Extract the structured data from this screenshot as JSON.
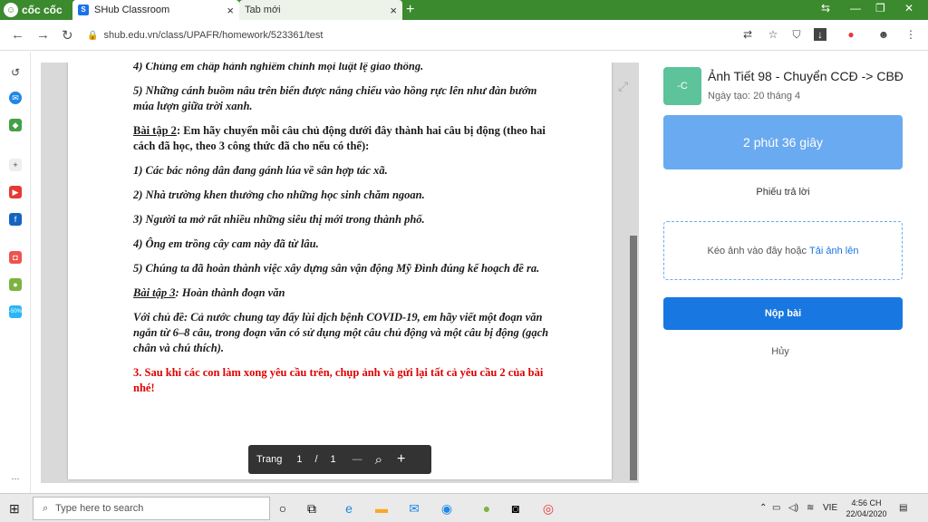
{
  "browser": {
    "brand": "cốc cốc",
    "tabs": [
      {
        "title": "SHub Classroom",
        "close": "×"
      },
      {
        "title": "Tab mới",
        "close": "×"
      }
    ],
    "new_tab": "+",
    "url": "shub.edu.vn/class/UPAFR/homework/523361/test"
  },
  "document": {
    "lines": [
      {
        "text": "4) Chúng em chấp hành nghiêm chỉnh mọi luật lệ giao thông.",
        "style": "it"
      },
      {
        "text": "5) Những cánh buồm nâu trên biển được nắng chiếu vào hồng rực lên như đàn bướm múa lượn giữa trời xanh.",
        "style": "it"
      },
      {
        "label": "Bài tập 2",
        "text": ": Em hãy chuyển mỗi câu chủ động dưới đây thành hai câu bị động (theo hai cách đã học, theo 3 công thức đã cho nếu có thể):",
        "style": "plain"
      },
      {
        "text": "1) Các bác nông dân đang gánh lúa về sân hợp tác xã.",
        "style": "it"
      },
      {
        "text": "2) Nhà trường khen thưởng cho những học sinh chăm ngoan.",
        "style": "it"
      },
      {
        "text": "3) Người ta mở rất nhiều những siêu thị mới trong thành phố.",
        "style": "it"
      },
      {
        "text": "4) Ông em trồng cây cam này đã từ lâu.",
        "style": "it"
      },
      {
        "text": "5) Chúng ta đã hoàn thành việc xây dựng sân vận động Mỹ Đình đúng kế hoạch đề ra.",
        "style": "it"
      },
      {
        "label": "Bài tập 3",
        "text": ": Hoàn thành đoạn văn",
        "style": "it"
      },
      {
        "text": "Với chủ đề: Cả nước chung tay đẩy lùi dịch bệnh COVID-19, em hãy viết một đoạn văn ngắn từ 6–8 câu, trong đoạn văn có sử dụng một câu chủ động và một câu bị động (gạch chân và chú thích).",
        "style": "it"
      },
      {
        "text": " 3. Sau khi các con làm xong yêu cầu trên, chụp ảnh và gửi lại tất cả yêu cầu 2 của bài nhé!",
        "style": "red"
      }
    ]
  },
  "pager": {
    "label": "Trang",
    "current": "1",
    "sep": "/",
    "total": "1",
    "minus": "—",
    "zoom": "⌕",
    "plus": "+"
  },
  "panel": {
    "avatar": "-C",
    "title": "Ảnh Tiết 98 - Chuyển CCĐ -> CBĐ",
    "created": "Ngày tạo: 20 tháng 4",
    "timer": "2 phút 36 giây",
    "answer_sheet": "Phiếu trả lời",
    "drop_text": "Kéo ảnh vào đây hoặc",
    "upload_link": "Tải ảnh lên",
    "submit": "Nộp bài",
    "cancel": "Hủy"
  },
  "taskbar": {
    "search_placeholder": "Type here to search",
    "lang": "VIE",
    "time": "4:56 CH",
    "date": "22/04/2020"
  },
  "colors": {
    "browser_green": "#3b8a2d",
    "timer_blue": "#6aaaf0",
    "submit_blue": "#1877e0",
    "red_note": "#e00000"
  }
}
